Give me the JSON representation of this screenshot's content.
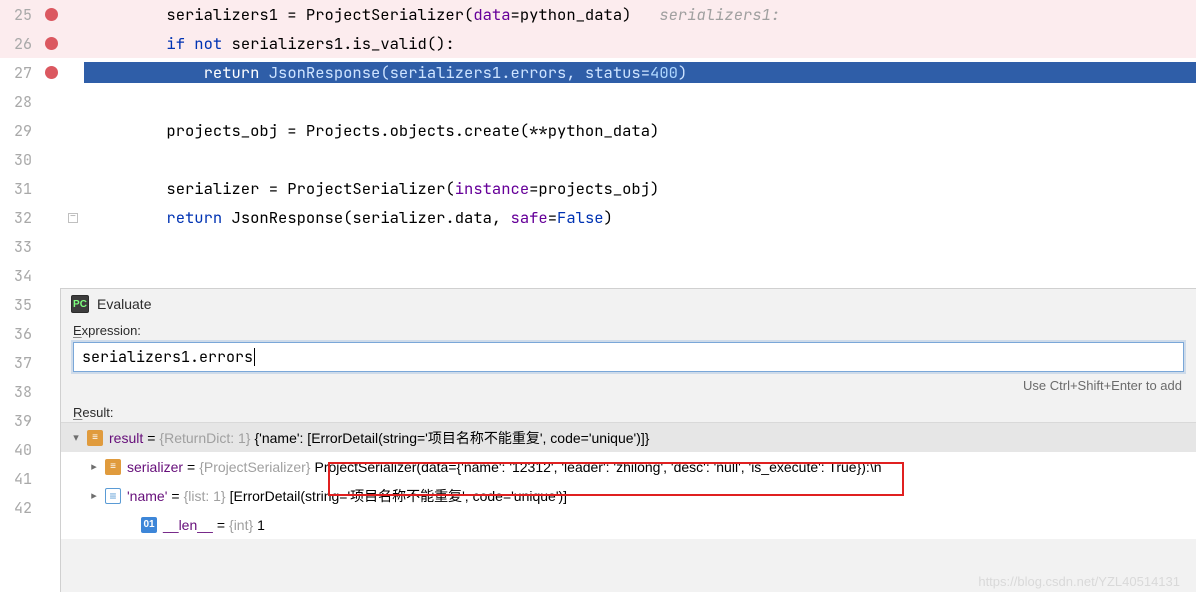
{
  "lines": {
    "l25": {
      "num": "25",
      "a": "serializers1 = ProjectSerializer(",
      "p": "data",
      "b": "=python_data)   ",
      "hint": "serializers1:"
    },
    "l26": {
      "num": "26",
      "kw1": "if not ",
      "a": "serializers1.is_valid():"
    },
    "l27": {
      "num": "27",
      "kw": "return ",
      "a": "JsonResponse(serializers1.errors, ",
      "p": "status",
      "b": "=",
      "n": "400",
      "c": ")"
    },
    "l28": {
      "num": "28"
    },
    "l29": {
      "num": "29",
      "a": "projects_obj = Projects.objects.create(**python_data)"
    },
    "l30": {
      "num": "30"
    },
    "l31": {
      "num": "31",
      "a": "serializer = ProjectSerializer(",
      "p": "instance",
      "b": "=projects_obj)"
    },
    "l32": {
      "num": "32",
      "kw": "return ",
      "a": "JsonResponse(serializer.data, ",
      "p": "safe",
      "b": "=",
      "v": "False",
      "c": ")"
    },
    "l33": {
      "num": "33"
    },
    "l34": {
      "num": "34"
    },
    "l35": {
      "num": "35"
    },
    "l36": {
      "num": "36"
    },
    "l37": {
      "num": "37"
    },
    "l38": {
      "num": "38"
    },
    "l39": {
      "num": "39"
    },
    "l40": {
      "num": "40"
    },
    "l41": {
      "num": "41"
    },
    "l42": {
      "num": "42"
    }
  },
  "eval": {
    "title": "Evaluate",
    "expression_label": "Expression:",
    "expression_value": "serializers1.errors",
    "hint": "Use Ctrl+Shift+Enter to add",
    "result_label": "Result:"
  },
  "tree": {
    "r0": {
      "name": "result",
      "eq": " = ",
      "type": "{ReturnDict: 1} ",
      "val": "{'name': [ErrorDetail(string='项目名称不能重复', code='unique')]}"
    },
    "r1": {
      "name": "serializer",
      "eq": " = ",
      "type": "{ProjectSerializer} ",
      "val": "ProjectSerializer(data={'name': '12312', 'leader': 'zhilong', 'desc': 'null', 'is_execute': True}):\\n"
    },
    "r2": {
      "name": "'name'",
      "eq": " = ",
      "type": "{list: 1} ",
      "val": "[ErrorDetail(string='项目名称不能重复', code='unique')]"
    },
    "r3": {
      "name": "__len__",
      "eq": " = ",
      "type": "{int} ",
      "val": "1"
    }
  },
  "watermark": "https://blog.csdn.net/YZL40514131"
}
